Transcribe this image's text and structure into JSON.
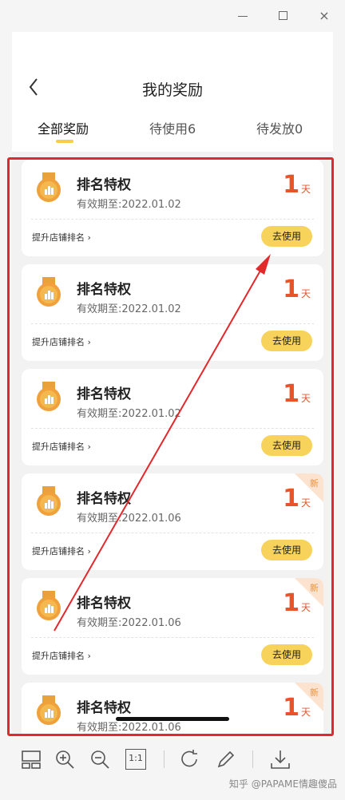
{
  "window": {
    "minimize": "—",
    "maximize": "☐",
    "close": "×"
  },
  "header": {
    "title": "我的奖励"
  },
  "tabs": [
    {
      "label": "全部奖励",
      "active": true
    },
    {
      "label": "待使用6",
      "active": false
    },
    {
      "label": "待发放0",
      "active": false
    }
  ],
  "cards": [
    {
      "title": "排名特权",
      "validity": "有效期至:2022.01.02",
      "days": "1",
      "days_unit": "天",
      "link": "提升店铺排名",
      "button": "去使用",
      "new": ""
    },
    {
      "title": "排名特权",
      "validity": "有效期至:2022.01.02",
      "days": "1",
      "days_unit": "天",
      "link": "提升店铺排名",
      "button": "去使用",
      "new": ""
    },
    {
      "title": "排名特权",
      "validity": "有效期至:2022.01.02",
      "days": "1",
      "days_unit": "天",
      "link": "提升店铺排名",
      "button": "去使用",
      "new": ""
    },
    {
      "title": "排名特权",
      "validity": "有效期至:2022.01.06",
      "days": "1",
      "days_unit": "天",
      "link": "提升店铺排名",
      "button": "去使用",
      "new": "新"
    },
    {
      "title": "排名特权",
      "validity": "有效期至:2022.01.06",
      "days": "1",
      "days_unit": "天",
      "link": "提升店铺排名",
      "button": "去使用",
      "new": "新"
    },
    {
      "title": "排名特权",
      "validity": "有效期至:2022.01.06",
      "days": "1",
      "days_unit": "天",
      "link": "",
      "button": "",
      "new": "新"
    }
  ],
  "toolbar": {
    "icons": [
      "layout-icon",
      "zoom-in-icon",
      "zoom-out-icon",
      "actual-size-icon",
      "rotate-icon",
      "edit-icon",
      "download-icon"
    ],
    "actual_size_label": "1:1",
    "watermark": "知乎 @PAPAME情趣傻品"
  },
  "colors": {
    "accent": "#f7d35c",
    "days": "#e8542a",
    "highlight": "#e3282c"
  }
}
